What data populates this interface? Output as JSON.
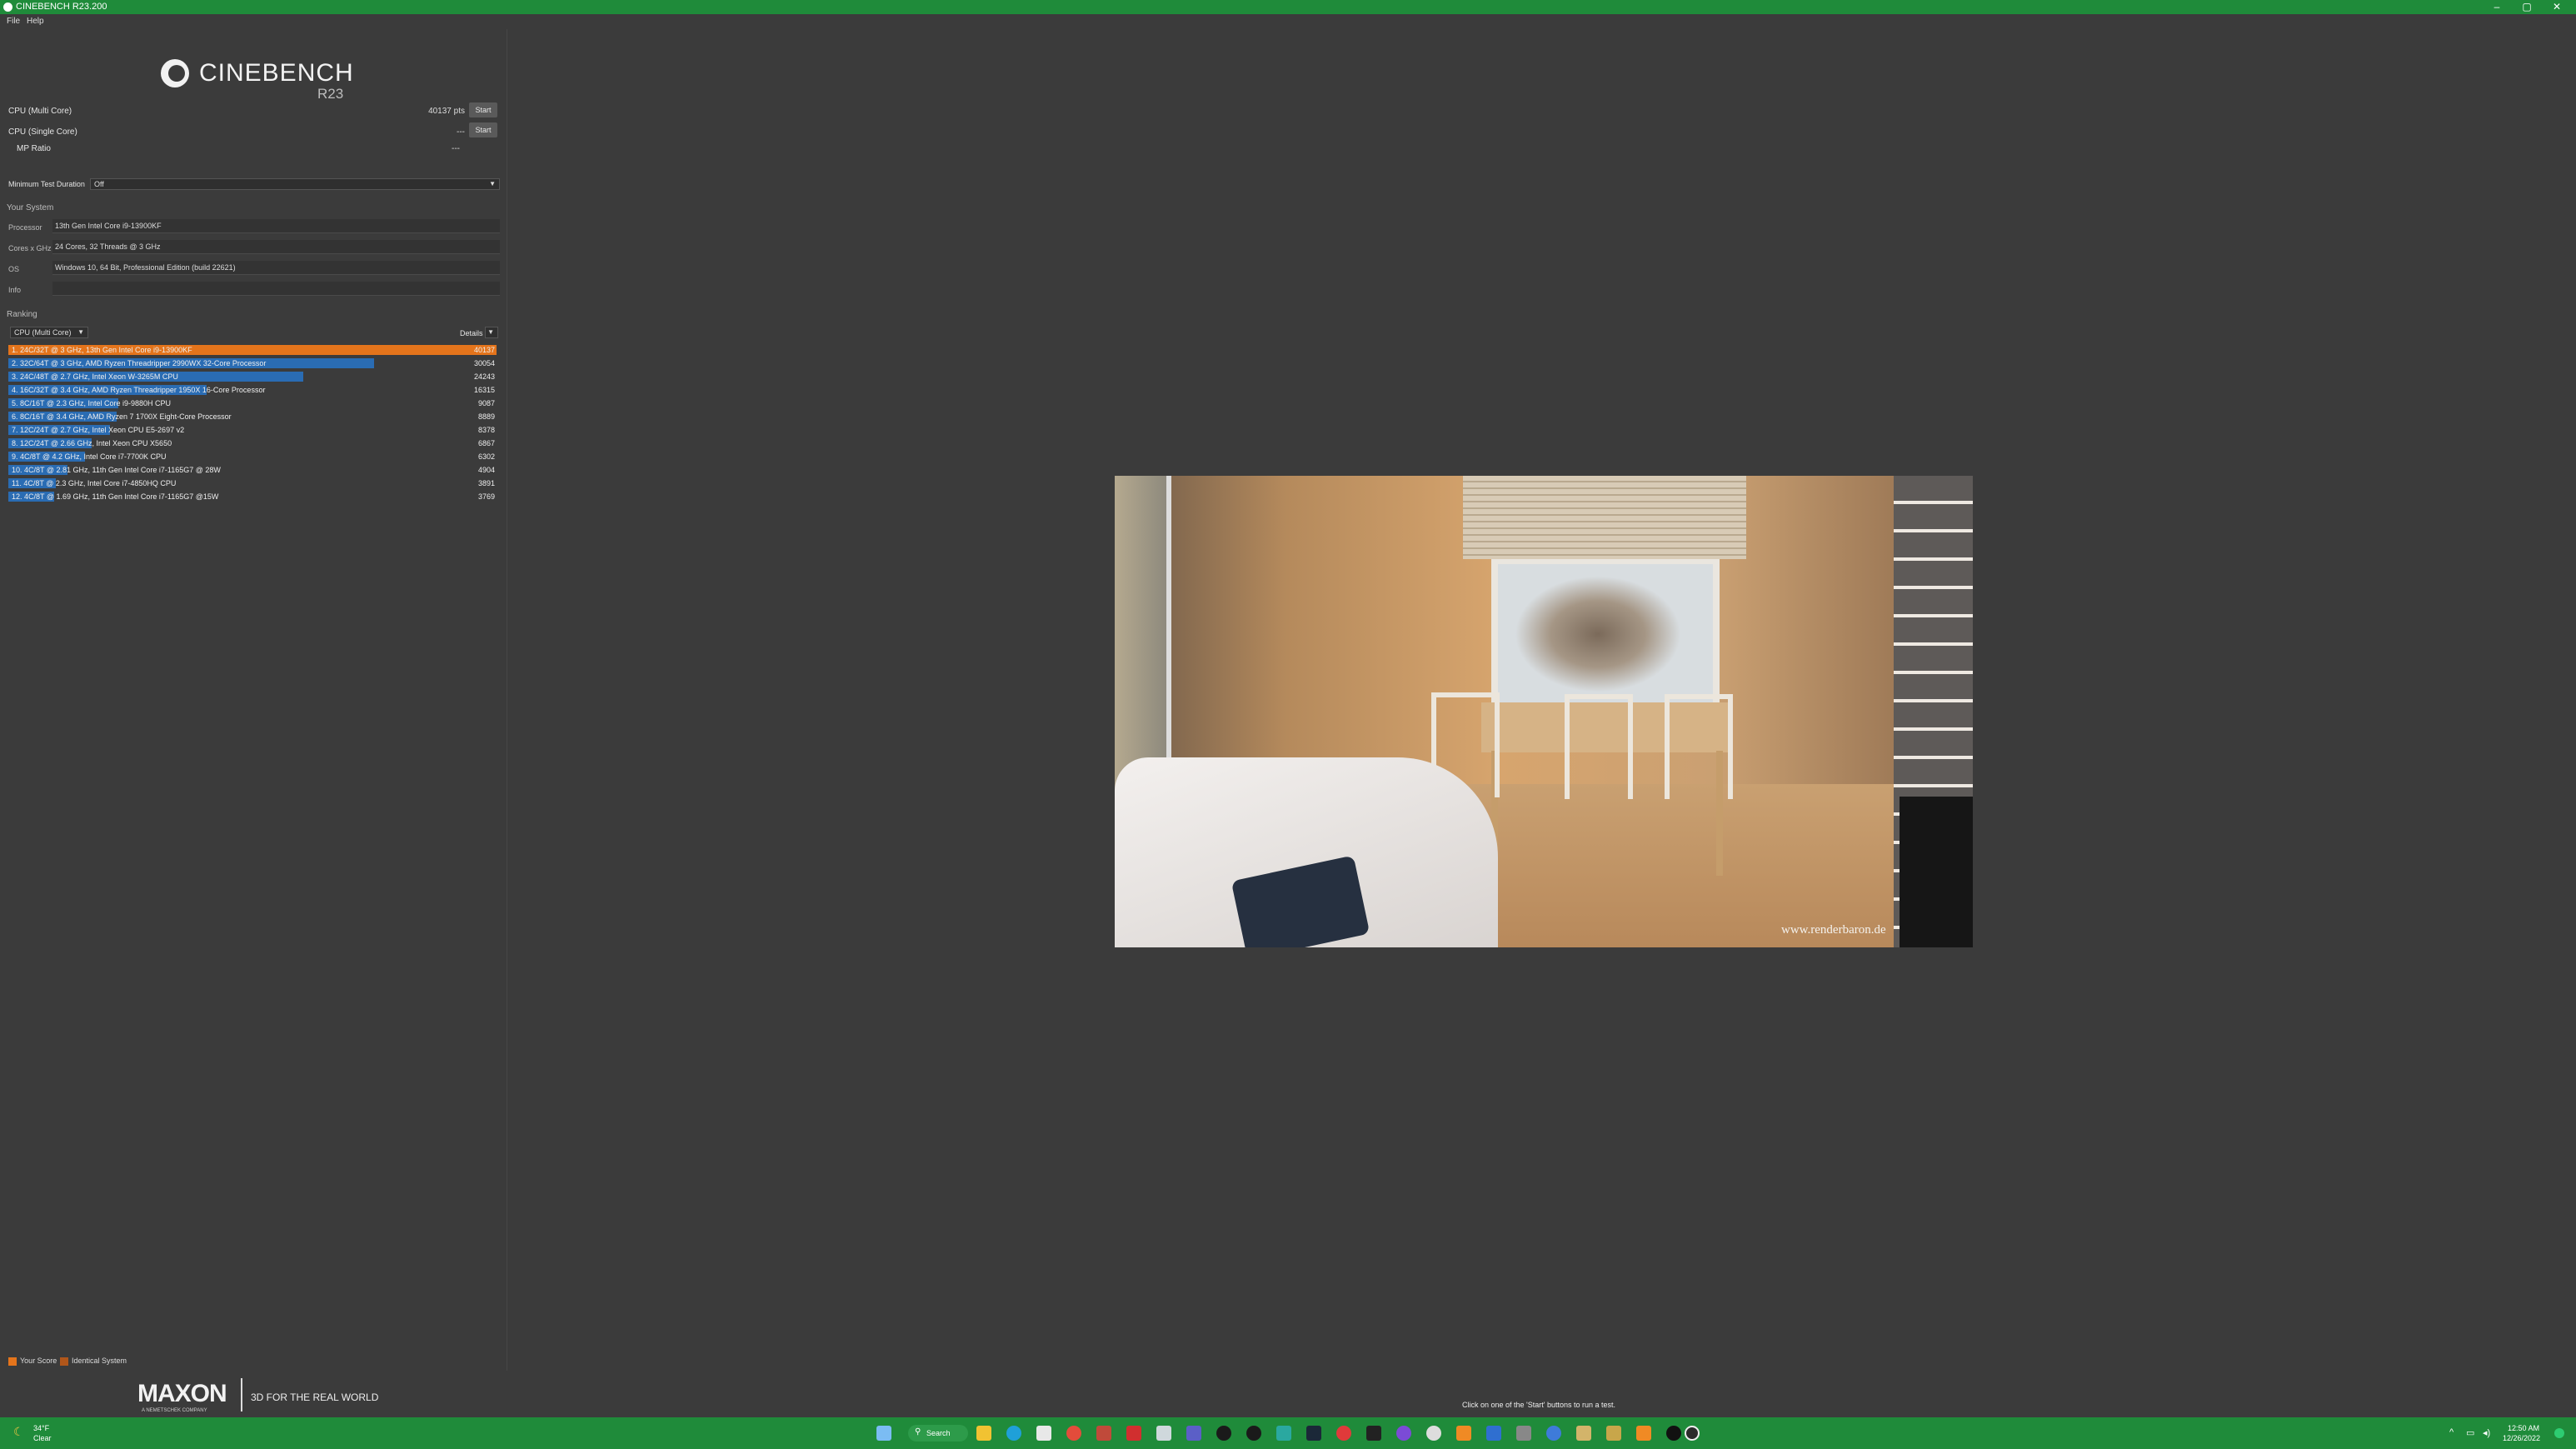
{
  "window": {
    "title": "CINEBENCH R23.200",
    "minimize": "–",
    "maximize": "▢",
    "close": "✕"
  },
  "menu": {
    "file": "File",
    "help": "Help"
  },
  "logo": {
    "word": "CINEBENCH",
    "version": "R23"
  },
  "tests": {
    "multi_label": "CPU (Multi Core)",
    "multi_score": "40137 pts",
    "single_label": "CPU (Single Core)",
    "single_score": "---",
    "mp_label": "MP Ratio",
    "mp_value": "---",
    "start_label": "Start"
  },
  "min_duration": {
    "label": "Minimum Test Duration",
    "value": "Off"
  },
  "system": {
    "heading": "Your System",
    "processor_label": "Processor",
    "processor": "13th Gen Intel Core i9-13900KF",
    "cores_label": "Cores x GHz",
    "cores": "24 Cores, 32 Threads @ 3 GHz",
    "os_label": "OS",
    "os": "Windows 10, 64 Bit, Professional Edition (build 22621)",
    "info_label": "Info",
    "info": ""
  },
  "ranking": {
    "heading": "Ranking",
    "selector": "CPU (Multi Core)",
    "details": "Details",
    "rows": [
      {
        "label": "1. 24C/32T @ 3 GHz, 13th Gen Intel Core i9-13900KF",
        "value": "40137",
        "fill": 1.0,
        "mine": true
      },
      {
        "label": "2. 32C/64T @ 3 GHz, AMD Ryzen Threadripper 2990WX 32-Core Processor",
        "value": "30054",
        "fill": 0.749,
        "mine": false
      },
      {
        "label": "3. 24C/48T @ 2.7 GHz, Intel Xeon W-3265M CPU",
        "value": "24243",
        "fill": 0.604,
        "mine": false
      },
      {
        "label": "4. 16C/32T @ 3.4 GHz, AMD Ryzen Threadripper 1950X 16-Core Processor",
        "value": "16315",
        "fill": 0.406,
        "mine": false
      },
      {
        "label": "5. 8C/16T @ 2.3 GHz, Intel Core i9-9880H CPU",
        "value": "9087",
        "fill": 0.226,
        "mine": false
      },
      {
        "label": "6. 8C/16T @ 3.4 GHz, AMD Ryzen 7 1700X Eight-Core Processor",
        "value": "8889",
        "fill": 0.221,
        "mine": false
      },
      {
        "label": "7. 12C/24T @ 2.7 GHz, Intel Xeon CPU E5-2697 v2",
        "value": "8378",
        "fill": 0.209,
        "mine": false
      },
      {
        "label": "8. 12C/24T @ 2.66 GHz, Intel Xeon CPU X5650",
        "value": "6867",
        "fill": 0.171,
        "mine": false
      },
      {
        "label": "9. 4C/8T @ 4.2 GHz, Intel Core i7-7700K CPU",
        "value": "6302",
        "fill": 0.157,
        "mine": false
      },
      {
        "label": "10. 4C/8T @ 2.81 GHz, 11th Gen Intel Core i7-1165G7 @ 28W",
        "value": "4904",
        "fill": 0.122,
        "mine": false
      },
      {
        "label": "11. 4C/8T @ 2.3 GHz, Intel Core i7-4850HQ CPU",
        "value": "3891",
        "fill": 0.097,
        "mine": false
      },
      {
        "label": "12. 4C/8T @ 1.69 GHz, 11th Gen Intel Core i7-1165G7 @15W",
        "value": "3769",
        "fill": 0.094,
        "mine": false
      }
    ]
  },
  "legend": {
    "your_score": "Your Score",
    "identical": "Identical System"
  },
  "footer": {
    "brand": "MAXON",
    "brand_sub": "A NEMETSCHEK COMPANY",
    "tagline": "3D FOR THE REAL WORLD",
    "hint": "Click on one of the 'Start' buttons to run a test."
  },
  "render": {
    "watermark": "www.renderbaron.de"
  },
  "taskbar": {
    "weather_temp": "34°F",
    "weather_cond": "Clear",
    "search": "Search",
    "time": "12:50 AM",
    "date": "12/26/2022"
  },
  "colors": {
    "accent_green": "#1f8b3a",
    "my_score": "#e4741b",
    "other_score": "#2a6cb3"
  }
}
